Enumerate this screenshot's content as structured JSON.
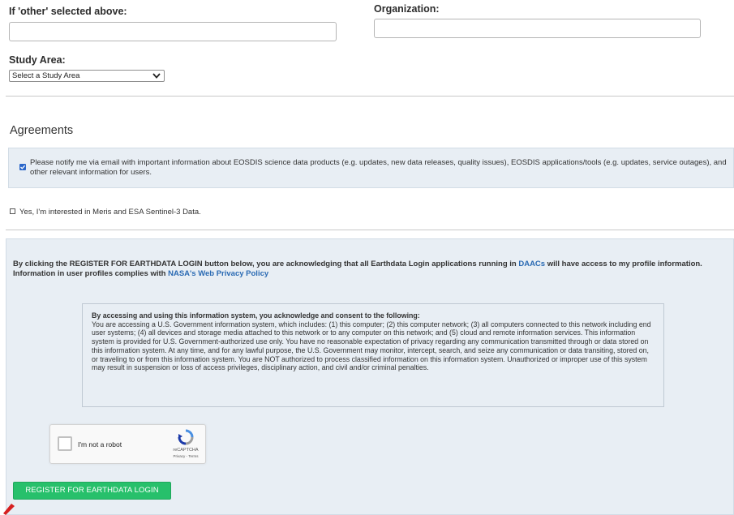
{
  "fields": {
    "other_label": "If 'other' selected above:",
    "other_value": "",
    "organization_label": "Organization:",
    "organization_value": "",
    "study_area_label": "Study Area:",
    "study_area_selected": "Select a Study Area"
  },
  "agreements": {
    "title": "Agreements",
    "notify_checked": true,
    "notify_text": "Please notify me via email with important information about EOSDIS science data products (e.g. updates, new data releases, quality issues), EOSDIS applications/tools (e.g. updates, service outages), and other relevant information for users.",
    "meris_checked": false,
    "meris_text": "Yes, I'm interested in Meris and ESA Sentinel-3 Data."
  },
  "acknowledgement": {
    "part1": "By clicking the REGISTER FOR EARTHDATA LOGIN button below, you are acknowledging that all Earthdata Login applications running in ",
    "daacs_link": "DAACs",
    "part2": " will have access to my profile information. Information in user profiles complies with ",
    "privacy_link": "NASA's Web Privacy Policy"
  },
  "consent": {
    "heading": "By accessing and using this information system, you acknowledge and consent to the following:",
    "body": "You are accessing a U.S. Government information system, which includes: (1) this computer; (2) this computer network; (3) all computers connected to this network including end user systems; (4) all devices and storage media attached to this network or to any computer on this network; and (5) cloud and remote information services. This information system is provided for U.S. Government-authorized use only. You have no reasonable expectation of privacy regarding any communication transmitted through or data stored on this information system. At any time, and for any lawful purpose, the U.S. Government may monitor, intercept, search, and seize any communication or data transiting, stored on, or traveling to or from this information system. You are NOT authorized to process classified information on this information system. Unauthorized or improper use of this system may result in suspension or loss of access privileges, disciplinary action, and civil and/or criminal penalties."
  },
  "captcha": {
    "label": "I'm not a robot",
    "brand": "reCAPTCHA",
    "links": "Privacy - Terms"
  },
  "register_button": "REGISTER FOR EARTHDATA LOGIN",
  "colors": {
    "accent_green": "#27c06b",
    "link_blue": "#2a6ab3",
    "panel_bg": "#e8eef4",
    "checkbox_blue": "#2a66c9"
  }
}
